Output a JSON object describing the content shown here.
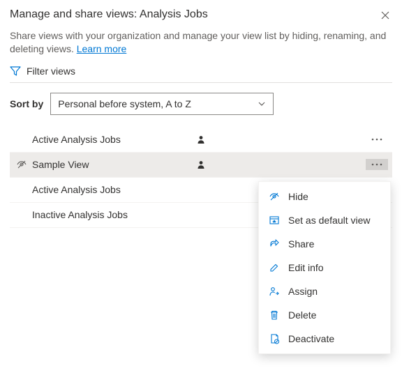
{
  "header": {
    "title": "Manage and share views: Analysis Jobs"
  },
  "description": {
    "text": "Share views with your organization and manage your view list by hiding, renaming, and deleting views. ",
    "link_text": "Learn more"
  },
  "filter": {
    "label": "Filter views"
  },
  "sort": {
    "label": "Sort by",
    "selected": "Personal before system, A to Z"
  },
  "views": [
    {
      "label": "Active Analysis Jobs",
      "personal": true,
      "hidden": false,
      "selected": false
    },
    {
      "label": "Sample View",
      "personal": true,
      "hidden": true,
      "selected": true
    },
    {
      "label": "Active Analysis Jobs",
      "personal": false,
      "hidden": false,
      "selected": false
    },
    {
      "label": "Inactive Analysis Jobs",
      "personal": false,
      "hidden": false,
      "selected": false
    }
  ],
  "context_menu": {
    "items": [
      {
        "label": "Hide",
        "icon": "hide-icon"
      },
      {
        "label": "Set as default view",
        "icon": "default-view-icon"
      },
      {
        "label": "Share",
        "icon": "share-icon"
      },
      {
        "label": "Edit info",
        "icon": "edit-icon"
      },
      {
        "label": "Assign",
        "icon": "assign-icon"
      },
      {
        "label": "Delete",
        "icon": "delete-icon"
      },
      {
        "label": "Deactivate",
        "icon": "deactivate-icon"
      }
    ]
  }
}
